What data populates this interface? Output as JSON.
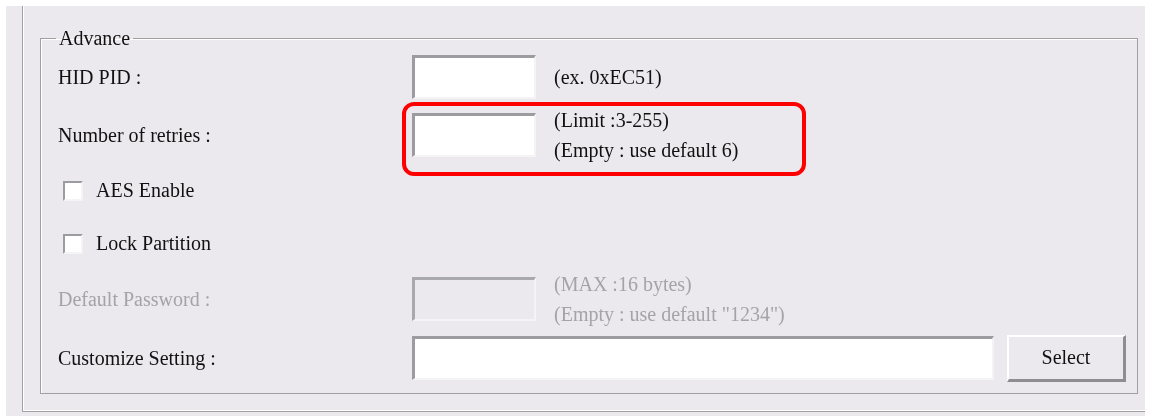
{
  "group": {
    "title": "Advance",
    "rows": [
      {
        "kind": "field",
        "label": "HID PID :",
        "hints": [
          "(ex. 0xEC51)"
        ],
        "disabled": false,
        "highlighted": false
      },
      {
        "kind": "field",
        "label": "Number of retries :",
        "hints": [
          "(Limit :3-255)",
          "(Empty : use default 6)"
        ],
        "disabled": false,
        "highlighted": true
      },
      {
        "kind": "checkbox",
        "label": "AES Enable",
        "checked": false
      },
      {
        "kind": "checkbox",
        "label": "Lock Partition",
        "checked": false
      },
      {
        "kind": "field",
        "label": "Default Password :",
        "hints": [
          "(MAX :16 bytes)",
          "(Empty : use default \"1234\")"
        ],
        "disabled": true,
        "highlighted": false
      },
      {
        "kind": "file",
        "label": "Customize Setting :",
        "button": "Select"
      }
    ]
  }
}
